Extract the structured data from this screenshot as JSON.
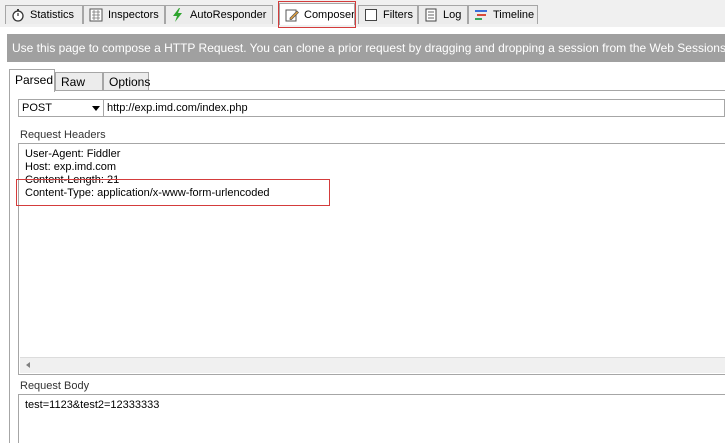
{
  "tabs": [
    {
      "label": "Statistics",
      "icon": "stopwatch-icon"
    },
    {
      "label": "Inspectors",
      "icon": "inspector-icon"
    },
    {
      "label": "AutoResponder",
      "icon": "lightning-icon"
    },
    {
      "label": "Composer",
      "icon": "pencil-paper-icon",
      "active": true
    },
    {
      "label": "Filters",
      "icon": "checkbox-icon"
    },
    {
      "label": "Log",
      "icon": "log-icon"
    },
    {
      "label": "Timeline",
      "icon": "timeline-icon"
    }
  ],
  "banner": "Use this page to compose a HTTP Request. You can clone a prior request by dragging and dropping a session from the Web Sessions list.",
  "subtabs": [
    "Parsed",
    "Raw",
    "Options"
  ],
  "request": {
    "method": "POST",
    "url": "http://exp.imd.com/index.php"
  },
  "headers_label": "Request Headers",
  "headers": [
    "User-Agent: Fiddler",
    "Host: exp.imd.com",
    "Content-Length: 21",
    "Content-Type: application/x-www-form-urlencoded"
  ],
  "body_label": "Request Body",
  "body": "test=1123&test2=12333333",
  "colors": {
    "highlight": "#d43c3c",
    "banner_bg": "#a0a0a0",
    "lightning": "#2fa52f"
  }
}
